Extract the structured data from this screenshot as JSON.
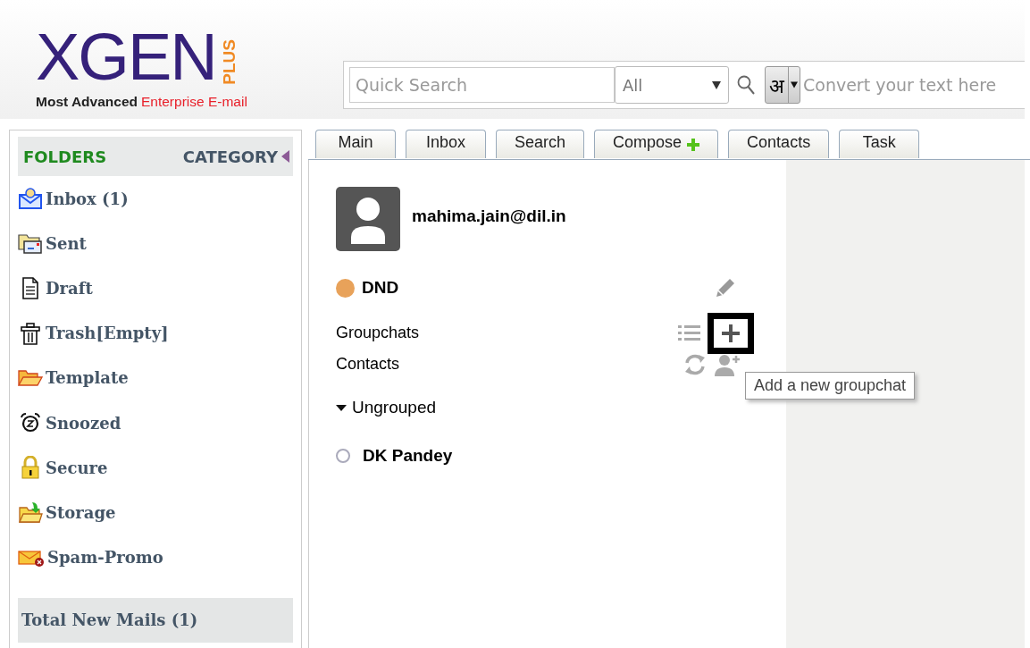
{
  "logo": {
    "wordmark": "XGEN",
    "badge": "PLUS",
    "tagline_start": "Most Advanced",
    "tagline_end": "Enterprise E-mail"
  },
  "search": {
    "placeholder": "Quick Search",
    "scope": "All",
    "script_key": "अ",
    "convert_placeholder": "Convert your text here"
  },
  "sidebar": {
    "header": "FOLDERS",
    "category": "CATEGORY",
    "items": [
      {
        "label": "Inbox (1)",
        "kind": "inbox"
      },
      {
        "label": "Sent",
        "kind": "sent"
      },
      {
        "label": "Draft",
        "kind": "draft"
      },
      {
        "label": "Trash[Empty]",
        "kind": "trash"
      },
      {
        "label": "Template",
        "kind": "template"
      },
      {
        "label": "Snoozed",
        "kind": "snoozed"
      },
      {
        "label": "Secure",
        "kind": "secure"
      },
      {
        "label": "Storage",
        "kind": "storage"
      },
      {
        "label": "Spam-Promo",
        "kind": "spam"
      }
    ],
    "footer": "Total New Mails (1)"
  },
  "tabs": [
    {
      "label": "Main",
      "selected": false
    },
    {
      "label": "Inbox",
      "selected": false
    },
    {
      "label": "Search",
      "selected": false
    },
    {
      "label": "Compose",
      "selected": false,
      "plus": true
    },
    {
      "label": "Contacts",
      "selected": false
    },
    {
      "label": "Task",
      "selected": false
    }
  ],
  "chat": {
    "user": "mahima.jain@dil.in",
    "status": {
      "label": "DND",
      "color": "#e8a25a"
    },
    "groupchats": "Groupchats",
    "contacts": "Contacts",
    "add_highlighted": true,
    "tooltip": "Add a new groupchat",
    "groups": [
      {
        "name": "Ungrouped",
        "expanded": true,
        "members": [
          {
            "name": "DK Pandey",
            "online": false
          }
        ]
      }
    ]
  }
}
